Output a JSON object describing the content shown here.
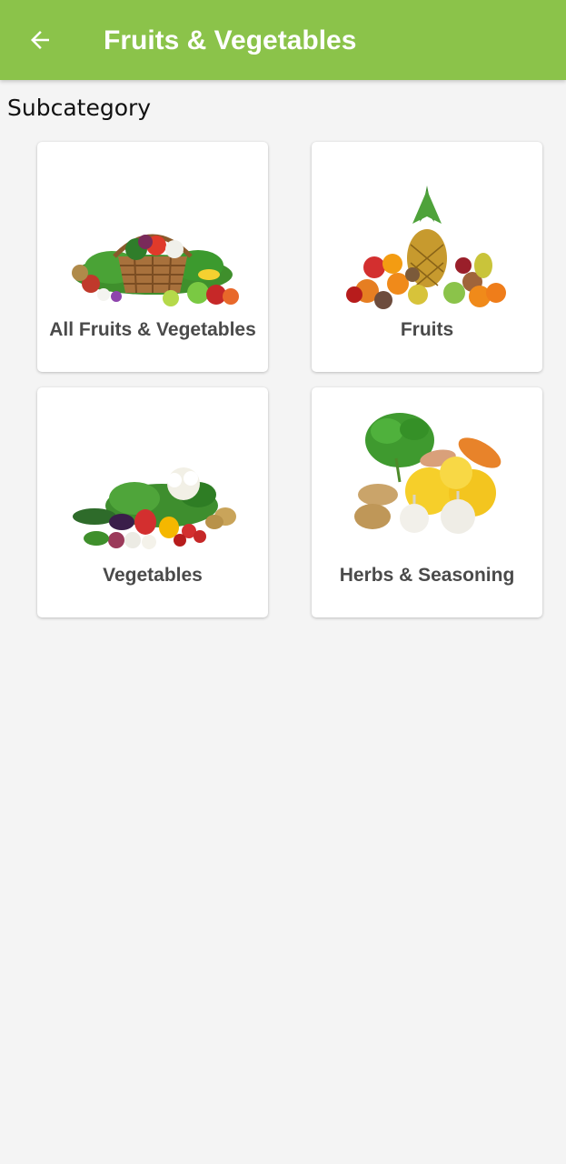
{
  "header": {
    "title": "Fruits & Vegetables",
    "back_icon": "arrow-left-icon",
    "color": "#8bc34a"
  },
  "section": {
    "title": "Subcategory"
  },
  "subcategories": [
    {
      "label": "All Fruits & Vegetables",
      "image": "fruit-vegetable-basket-image"
    },
    {
      "label": "Fruits",
      "image": "assorted-fruits-image"
    },
    {
      "label": "Vegetables",
      "image": "assorted-vegetables-image"
    },
    {
      "label": "Herbs & Seasoning",
      "image": "herbs-seasoning-image"
    }
  ]
}
